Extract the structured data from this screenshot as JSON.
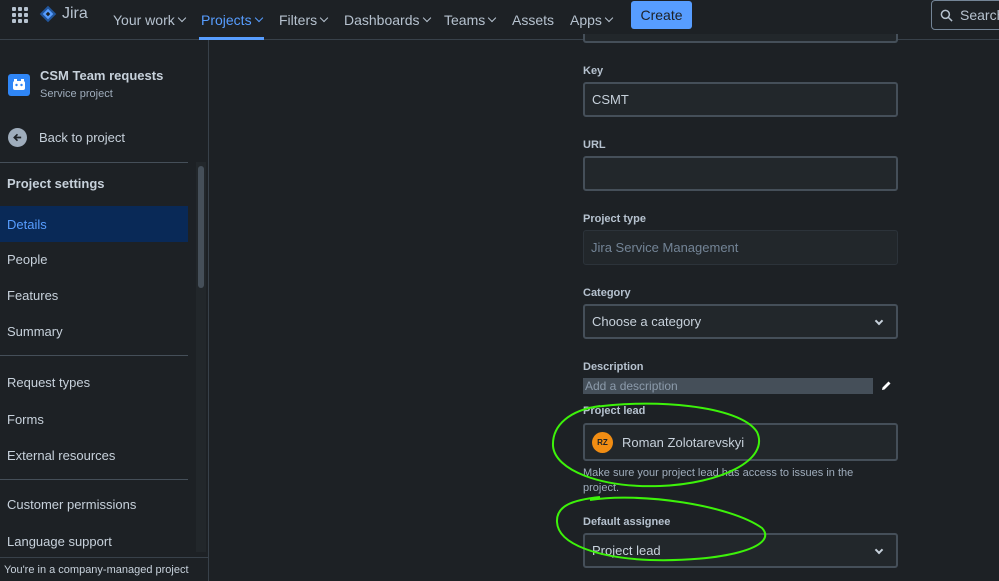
{
  "topnav": {
    "logo_text": "Jira",
    "items": [
      {
        "label": "Your work",
        "dropdown": true
      },
      {
        "label": "Projects",
        "dropdown": true,
        "active": true
      },
      {
        "label": "Filters",
        "dropdown": true
      },
      {
        "label": "Dashboards",
        "dropdown": true
      },
      {
        "label": "Teams",
        "dropdown": true
      },
      {
        "label": "Assets",
        "dropdown": false
      },
      {
        "label": "Apps",
        "dropdown": true
      }
    ],
    "create_label": "Create",
    "search_label": "Search"
  },
  "sidebar": {
    "project_name": "CSM Team requests",
    "project_type": "Service project",
    "back_label": "Back to project",
    "section_title": "Project settings",
    "items": [
      {
        "label": "Details",
        "active": true
      },
      {
        "label": "People"
      },
      {
        "label": "Features"
      },
      {
        "label": "Summary"
      },
      {
        "label": "Request types"
      },
      {
        "label": "Forms"
      },
      {
        "label": "External resources"
      },
      {
        "label": "Customer permissions"
      },
      {
        "label": "Language support"
      }
    ],
    "footer": "You're in a company-managed project"
  },
  "form": {
    "key_label": "Key",
    "key_value": "CSMT",
    "url_label": "URL",
    "url_value": "",
    "project_type_label": "Project type",
    "project_type_value": "Jira Service Management",
    "category_label": "Category",
    "category_value": "Choose a category",
    "description_label": "Description",
    "description_placeholder": "Add a description",
    "project_lead_label": "Project lead",
    "project_lead_initials": "RZ",
    "project_lead_name": "Roman Zolotarevskyi",
    "project_lead_helper": "Make sure your project lead has access to issues in the project.",
    "default_assignee_label": "Default assignee",
    "default_assignee_value": "Project lead"
  },
  "colors": {
    "accent": "#579dff",
    "background": "#1d2125",
    "annotation": "#3df20a",
    "avatar": "#f18d13"
  }
}
